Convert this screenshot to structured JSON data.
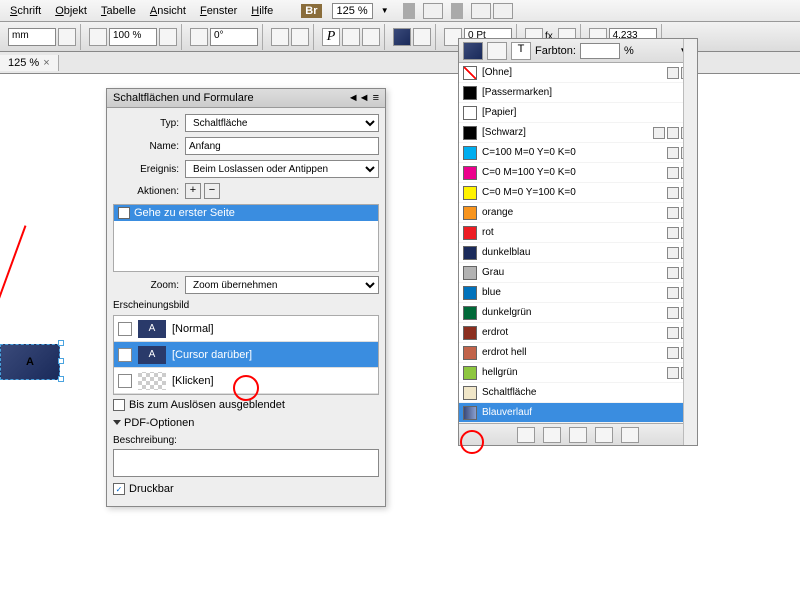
{
  "menu": {
    "items": [
      "Schrift",
      "Objekt",
      "Tabelle",
      "Ansicht",
      "Fenster",
      "Hilfe"
    ],
    "br": "Br",
    "zoom": "125 %"
  },
  "toolbar": {
    "pct": "100 %",
    "deg": "0°",
    "pt": "0 Pt",
    "coord": "4,233 mm",
    "farbton": "Farbton:",
    "farbton_unit": "%"
  },
  "doctab": {
    "label": "125 %",
    "close": "×"
  },
  "panel": {
    "title": "Schaltflächen und Formulare",
    "type_label": "Typ:",
    "type_value": "Schaltfläche",
    "name_label": "Name:",
    "name_value": "Anfang",
    "event_label": "Ereignis:",
    "event_value": "Beim Loslassen oder Antippen",
    "actions_label": "Aktionen:",
    "action_item": "Gehe zu erster Seite",
    "zoom_label": "Zoom:",
    "zoom_value": "Zoom übernehmen",
    "appearance_label": "Erscheinungsbild",
    "state_normal": "[Normal]",
    "state_hover": "[Cursor darüber]",
    "state_click": "[Klicken]",
    "thumb_a": "A",
    "hide_until": "Bis zum Auslösen ausgeblendet",
    "pdf_options": "PDF-Optionen",
    "desc_label": "Beschreibung:",
    "printable": "Druckbar"
  },
  "button": {
    "label": "A"
  },
  "swatches": {
    "farbton": "Farbton:",
    "unit": "%",
    "items": [
      {
        "name": "[Ohne]",
        "bg": "#fff",
        "diag": true,
        "i": [
          "x",
          "d"
        ]
      },
      {
        "name": "[Passermarken]",
        "bg": "#000",
        "i": []
      },
      {
        "name": "[Papier]",
        "bg": "#fff",
        "i": []
      },
      {
        "name": "[Schwarz]",
        "bg": "#000",
        "i": [
          "x",
          "p",
          "c"
        ]
      },
      {
        "name": "C=100 M=0 Y=0 K=0",
        "bg": "#00aeef",
        "i": [
          "p",
          "c"
        ]
      },
      {
        "name": "C=0 M=100 Y=0 K=0",
        "bg": "#ec008c",
        "i": [
          "p",
          "c"
        ]
      },
      {
        "name": "C=0 M=0 Y=100 K=0",
        "bg": "#fff200",
        "i": [
          "p",
          "c"
        ]
      },
      {
        "name": "orange",
        "bg": "#f7941d",
        "i": [
          "p",
          "c"
        ]
      },
      {
        "name": "rot",
        "bg": "#ed1c24",
        "i": [
          "p",
          "c"
        ]
      },
      {
        "name": "dunkelblau",
        "bg": "#1a2a5a",
        "i": [
          "p",
          "c"
        ]
      },
      {
        "name": "Grau",
        "bg": "#b3b3b3",
        "i": [
          "p",
          "g"
        ]
      },
      {
        "name": "blue",
        "bg": "#0072bc",
        "i": [
          "p",
          "c"
        ]
      },
      {
        "name": "dunkelgrün",
        "bg": "#006838",
        "i": [
          "p",
          "c"
        ]
      },
      {
        "name": "erdrot",
        "bg": "#8b2e1f",
        "i": [
          "p",
          "c"
        ]
      },
      {
        "name": "erdrot hell",
        "bg": "#c1634a",
        "i": [
          "p",
          "c"
        ]
      },
      {
        "name": "hellgrün",
        "bg": "#8dc63f",
        "i": [
          "p",
          "c"
        ]
      },
      {
        "name": "Schaltfläche",
        "bg": "#f0e6c8",
        "i": []
      },
      {
        "name": "Blauverlauf",
        "bg": "linear-gradient(90deg,#3a4a7a,#8aa0d0)",
        "i": [],
        "sel": true
      }
    ]
  }
}
